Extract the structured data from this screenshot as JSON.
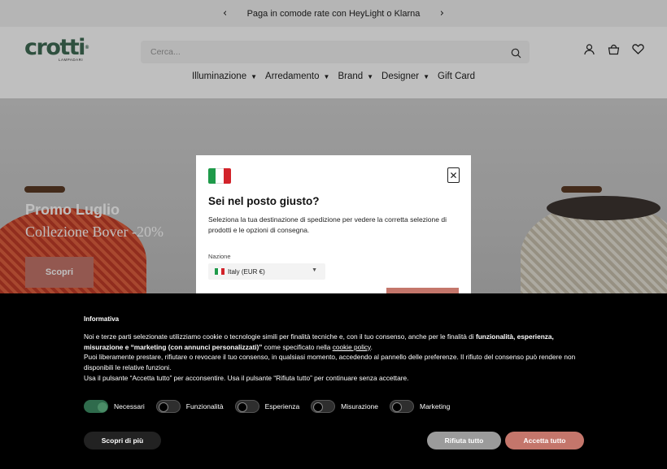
{
  "announcement": {
    "message": "Paga in comode rate con HeyLight o Klarna",
    "prev_icon": "chevron-left-icon",
    "next_icon": "chevron-right-icon"
  },
  "header": {
    "logo_text": "crotti",
    "logo_sub": "LAMPADARI",
    "search_placeholder": "Cerca...",
    "icons": [
      "user-icon",
      "basket-icon",
      "heart-icon"
    ]
  },
  "nav": [
    {
      "label": "Illuminazione",
      "dropdown": true
    },
    {
      "label": "Arredamento",
      "dropdown": true
    },
    {
      "label": "Brand",
      "dropdown": true
    },
    {
      "label": "Designer",
      "dropdown": true
    },
    {
      "label": "Gift Card",
      "dropdown": false
    }
  ],
  "hero": {
    "title": "Promo Luglio",
    "subtitle": "Collezione Bover -20%",
    "button": "Scopri"
  },
  "geo_modal": {
    "title": "Sei nel posto giusto?",
    "description": "Seleziona la tua destinazione di spedizione per vedere la corretta selezione di prodotti e le opzioni di consegna.",
    "country_label": "Nazione",
    "country_value": "Italy (EUR €)",
    "flag_colors": [
      "#1f9a4a",
      "#ffffff",
      "#d2232a"
    ]
  },
  "cookie_banner": {
    "title": "Informativa",
    "p1_a": "Noi e terze parti selezionate utilizziamo cookie o tecnologie simili per finalità tecniche e, con il tuo consenso, anche per le finalità di ",
    "p1_b": "funzionalità, esperienza, misurazione e “marketing (con annunci personalizzati)”",
    "p1_c": " come specificato nella ",
    "p1_link": "cookie policy",
    "p1_d": ".",
    "p2": "Puoi liberamente prestare, rifiutare o revocare il tuo consenso, in qualsiasi momento, accedendo al pannello delle preferenze. Il rifiuto del consenso può rendere non disponibili le relative funzioni.",
    "p3": "Usa il pulsante “Accetta tutto” per acconsentire. Usa il pulsante “Rifiuta tutto” per continuare senza accettare.",
    "toggles": [
      {
        "label": "Necessari",
        "on": true
      },
      {
        "label": "Funzionalità",
        "on": false
      },
      {
        "label": "Esperienza",
        "on": false
      },
      {
        "label": "Misurazione",
        "on": false
      },
      {
        "label": "Marketing",
        "on": false
      }
    ],
    "more_button": "Scopri di più",
    "refuse_button": "Rifiuta tutto",
    "accept_button": "Accetta tutto"
  }
}
